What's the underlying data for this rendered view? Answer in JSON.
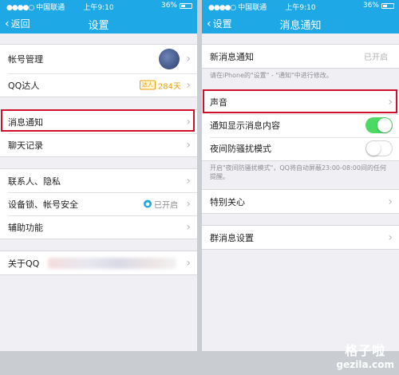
{
  "status_bar": {
    "carrier": "中国联通",
    "signal": "●●●●○",
    "time": "上午9:10",
    "battery": "36%"
  },
  "left": {
    "nav": {
      "back_label": "返回",
      "title": "设置"
    },
    "groups": [
      [
        {
          "label": "帐号管理"
        },
        {
          "label": "QQ达人",
          "badge_icon": "达人",
          "badge_value": "284天"
        }
      ],
      [
        {
          "label": "消息通知"
        },
        {
          "label": "聊天记录"
        }
      ],
      [
        {
          "label": "联系人、隐私"
        },
        {
          "label": "设备锁、帐号安全",
          "value": "已开启"
        },
        {
          "label": "辅助功能"
        }
      ],
      [
        {
          "label": "关于QQ"
        }
      ]
    ]
  },
  "right": {
    "nav": {
      "back_label": "设置",
      "title": "消息通知"
    },
    "new_msg": {
      "label": "新消息通知",
      "value": "已开启"
    },
    "new_msg_hint": "请在iPhone的\"设置\" - \"通知\"中进行修改。",
    "sound": {
      "label": "声音"
    },
    "show_content": {
      "label": "通知显示消息内容",
      "toggle": "on"
    },
    "night_mode": {
      "label": "夜间防骚扰模式",
      "toggle": "off"
    },
    "night_hint": "开启\"夜间防骚扰模式\"，QQ将自动屏蔽23:00-08:00间的任何提醒。",
    "special_care": {
      "label": "特别关心"
    },
    "group_msg": {
      "label": "群消息设置"
    }
  },
  "watermark": {
    "title": "格子啦",
    "url": "gezila.com"
  },
  "colors": {
    "nav": "#1fa8e6",
    "highlight": "#d0102a",
    "toggle_on": "#4cd964",
    "badge": "#e8a300"
  }
}
